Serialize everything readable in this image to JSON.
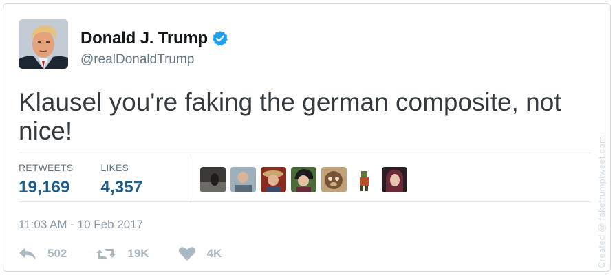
{
  "author": {
    "name": "Donald J. Trump",
    "handle": "@realDonaldTrump",
    "verified": true
  },
  "tweet": {
    "text": "Klausel you're faking the german composite, not nice!",
    "timestamp": "11:03 AM - 10 Feb 2017"
  },
  "stats": [
    {
      "label": "RETWEETS",
      "value": "19,169"
    },
    {
      "label": "LIKES",
      "value": "4,357"
    }
  ],
  "likers": [
    {
      "icon": "liker-avatar-1"
    },
    {
      "icon": "liker-avatar-2"
    },
    {
      "icon": "liker-avatar-3"
    },
    {
      "icon": "liker-avatar-4"
    },
    {
      "icon": "liker-avatar-5"
    },
    {
      "icon": "liker-avatar-6"
    },
    {
      "icon": "liker-avatar-7"
    }
  ],
  "actions": {
    "reply": {
      "icon": "reply-icon",
      "count": "502"
    },
    "retweet": {
      "icon": "retweet-icon",
      "count": "19K"
    },
    "like": {
      "icon": "heart-icon",
      "count": "4K"
    }
  },
  "watermark": "Created @ faketrumptweet.com",
  "colors": {
    "verified": "#1da1f2",
    "stat_value": "#1d5d8f",
    "muted": "#8899a6",
    "action": "#aab8c2"
  }
}
